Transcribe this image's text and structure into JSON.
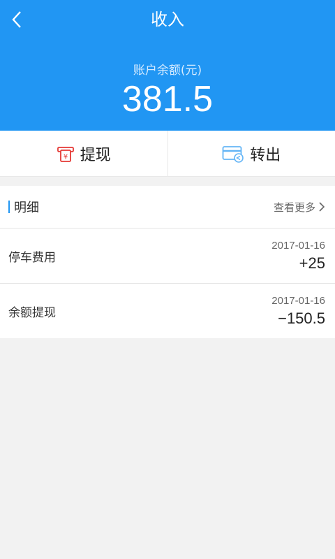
{
  "header": {
    "title": "收入",
    "balance_label": "账户余额(元)",
    "balance_value": "381.5"
  },
  "actions": [
    {
      "label": "提现",
      "icon": "withdraw-yen-icon"
    },
    {
      "label": "转出",
      "icon": "card-transfer-icon"
    }
  ],
  "details": {
    "title": "明细",
    "more_label": "查看更多",
    "items": [
      {
        "name": "停车费用",
        "date": "2017-01-16",
        "amount": "+25"
      },
      {
        "name": "余额提现",
        "date": "2017-01-16",
        "amount": "−150.5"
      }
    ]
  },
  "colors": {
    "primary": "#2196f3",
    "withdraw_icon": "#e53935",
    "card_icon": "#64b5f6"
  }
}
